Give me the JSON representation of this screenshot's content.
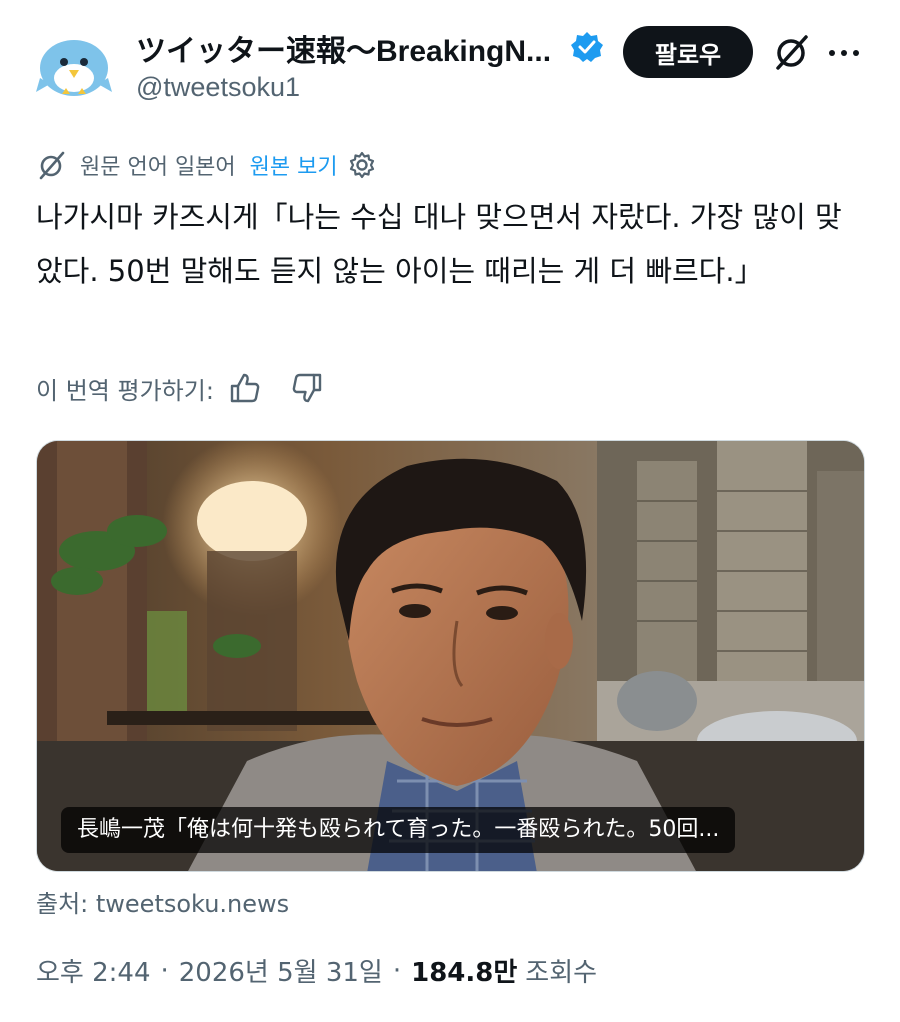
{
  "author": {
    "display_name": "ツイッター速報〜BreakingN...",
    "handle": "@tweetsoku1",
    "avatar_icon": "bird-avatar-icon",
    "verified_icon": "verified-badge-icon"
  },
  "header": {
    "follow_label": "팔로우",
    "grok_icon": "grok-icon",
    "more_icon": "more-icon"
  },
  "translation": {
    "source_language": "원문 언어 일본어",
    "show_original": "원본 보기",
    "settings_icon": "gear-icon"
  },
  "tweet": {
    "text": "나가시마 카즈시게「나는 수십 대나 맞으면서 자랐다. 가장 많이 맞았다. 50번 말해도 듣지 않는 아이는 때리는 게 더 빠르다.」"
  },
  "rate_translation": {
    "label": "이 번역 평가하기:"
  },
  "media": {
    "caption": "長嶋一茂「俺は何十発も殴られて育った。一番殴られた。50回..."
  },
  "source": {
    "text": "출처: tweetsoku.news"
  },
  "meta": {
    "time": "오후 2:44",
    "date": "2026년 5월 31일",
    "views_count": "184.8만",
    "views_label": "조회수"
  },
  "colors": {
    "accent": "#1d9bf0",
    "text": "#0f1419",
    "muted": "#536471",
    "follow_bg": "#0f1419"
  }
}
